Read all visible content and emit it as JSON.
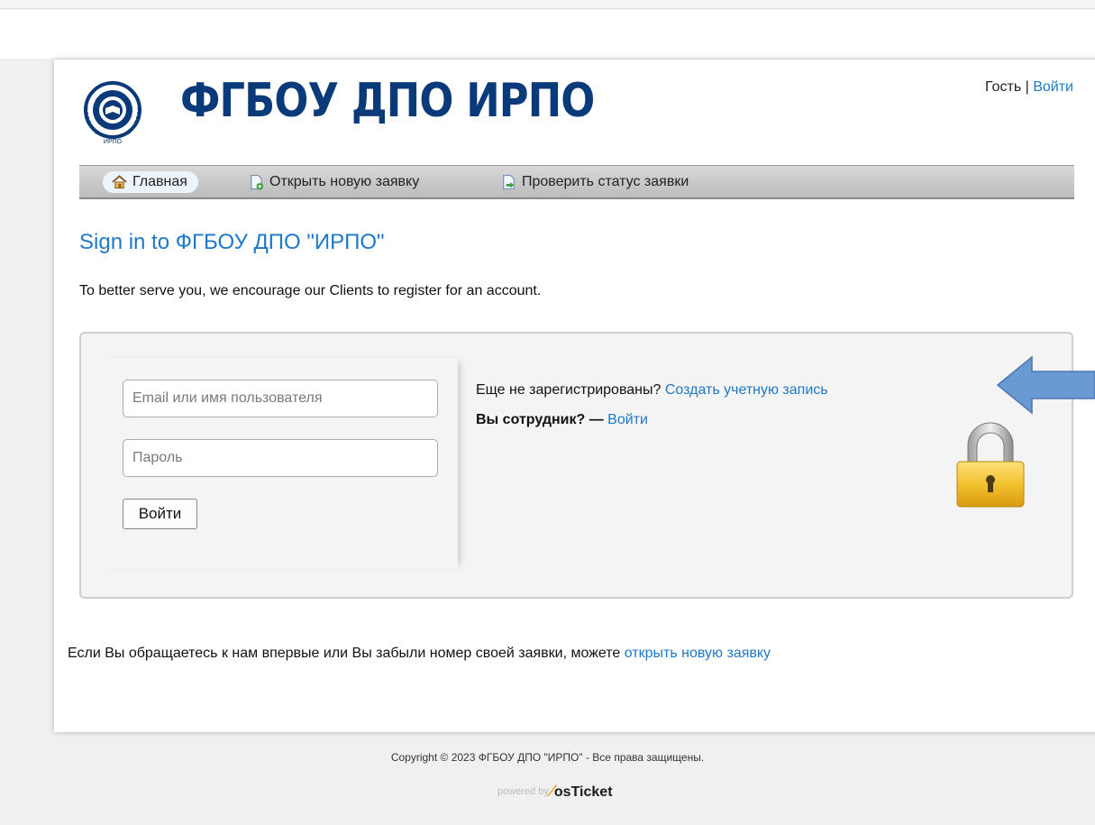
{
  "brand": {
    "name": "ФГБОУ ДПО ИРПО",
    "logo_text": "ИРПО"
  },
  "userbar": {
    "guest": "Гость",
    "separator": "|",
    "login": "Войти"
  },
  "nav": [
    {
      "label": "Главная",
      "icon": "home-icon"
    },
    {
      "label": "Открыть новую заявку",
      "icon": "new-ticket-icon"
    },
    {
      "label": "Проверить статус заявки",
      "icon": "check-status-icon"
    }
  ],
  "page": {
    "title": "Sign in to ФГБОУ ДПО \"ИРПО\"",
    "intro": "To better serve you, we encourage our Clients to register for an account."
  },
  "login_form": {
    "username_placeholder": "Email или имя пользователя",
    "password_placeholder": "Пароль",
    "submit_label": "Войти"
  },
  "register": {
    "question": "Еще не зарегистрированы?",
    "link": "Создать учетную запись"
  },
  "staff": {
    "question": "Вы сотрудник? —",
    "link": "Войти"
  },
  "footer_note": {
    "text": "Если Вы обращаетесь к нам впервые или Вы забыли номер своей заявки, можете",
    "link": "открыть новую заявку"
  },
  "footer": {
    "copyright": "Copyright © 2023 ФГБОУ ДПО \"ИРПО\" - Все права защищены.",
    "powered_by": "powered by",
    "product": "osTicket"
  },
  "colors": {
    "accent": "#1e78c8",
    "brand": "#0b3a7a",
    "arrow": "#6a9ad4"
  }
}
